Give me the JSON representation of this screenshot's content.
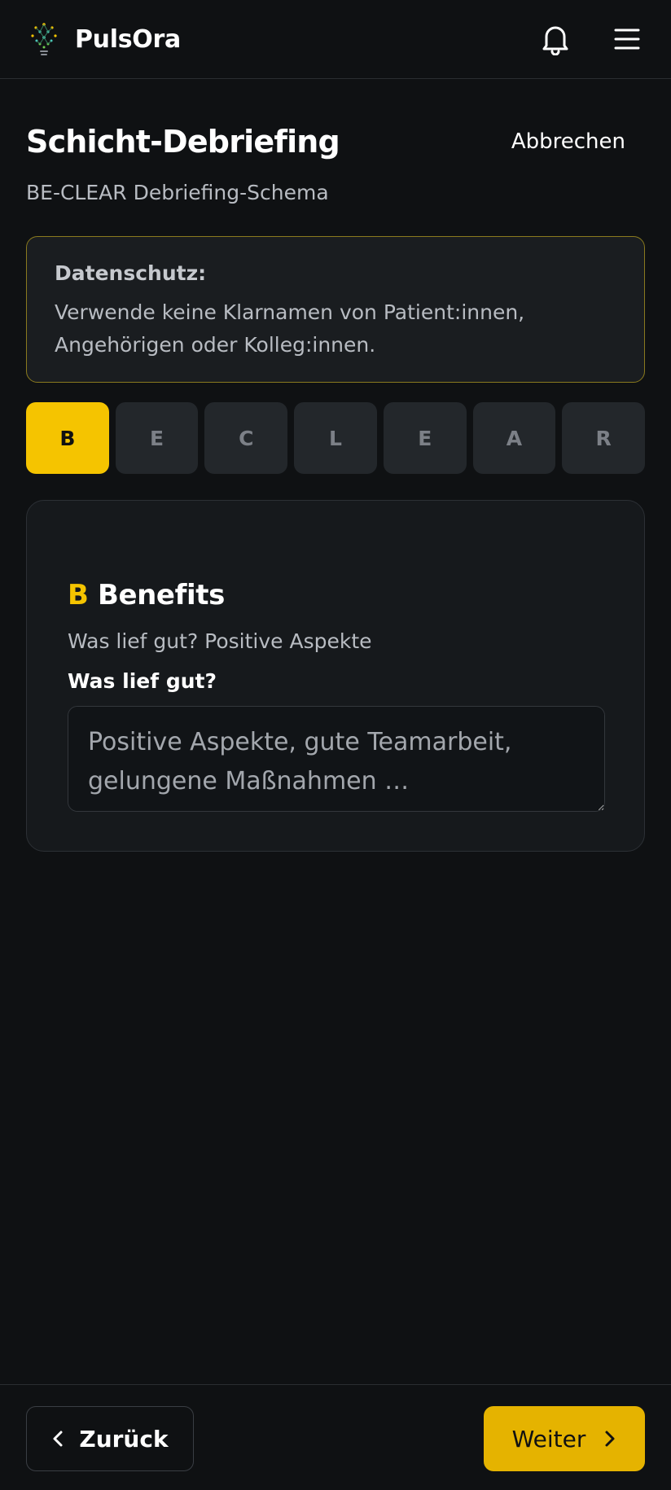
{
  "app": {
    "name": "PulsOra",
    "logo_icon": "lightbulb-network-icon",
    "notification_icon": "bell-icon",
    "menu_icon": "hamburger-menu-icon"
  },
  "page": {
    "title": "Schicht-Debriefing",
    "subtitle": "BE-CLEAR Debriefing-Schema",
    "cancel_label": "Abbrechen"
  },
  "notice": {
    "title": "Datenschutz:",
    "line1": "Verwende keine Klarnamen von Patient:innen,",
    "line2": "Angehörigen oder Kolleg:innen."
  },
  "steps": [
    {
      "label": "B",
      "active": true
    },
    {
      "label": "E",
      "active": false
    },
    {
      "label": "C",
      "active": false
    },
    {
      "label": "L",
      "active": false
    },
    {
      "label": "E",
      "active": false
    },
    {
      "label": "A",
      "active": false
    },
    {
      "label": "R",
      "active": false
    }
  ],
  "section": {
    "letter": "B",
    "title": "Benefits",
    "description": "Was lief gut? Positive Aspekte",
    "field_label": "Was lief gut?",
    "field_value": "",
    "field_placeholder": "Positive Aspekte, gute Teamarbeit, gelungene Maßnahmen …"
  },
  "footer": {
    "back_label": "Zurück",
    "next_label": "Weiter",
    "back_icon": "chevron-left-icon",
    "next_icon": "chevron-right-icon"
  },
  "colors": {
    "background": "#0f1113",
    "accent": "#f5c400",
    "accent_button": "#e5b300",
    "notice_border": "#8a7a1e"
  }
}
